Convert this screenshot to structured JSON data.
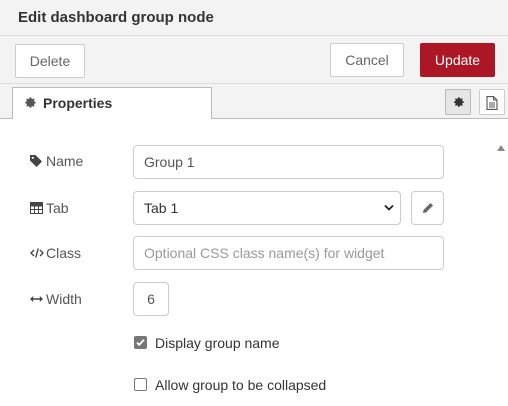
{
  "dialog": {
    "title": "Edit dashboard group node"
  },
  "toolbar": {
    "delete_label": "Delete",
    "cancel_label": "Cancel",
    "update_label": "Update"
  },
  "tabs": {
    "active_label": "Properties",
    "active_icon": "gear-icon",
    "icons": [
      "gear-icon",
      "document-icon"
    ]
  },
  "form": {
    "name": {
      "label": "Name",
      "icon": "tag-icon",
      "value": "Group 1"
    },
    "tab": {
      "label": "Tab",
      "icon": "table-icon",
      "selected": "Tab 1"
    },
    "class": {
      "label": "Class",
      "icon": "code-icon",
      "value": "",
      "placeholder": "Optional CSS class name(s) for widget"
    },
    "width": {
      "label": "Width",
      "icon": "arrows-h-icon",
      "value": "6"
    },
    "display_group_name": {
      "label": "Display group name",
      "checked": true
    },
    "allow_collapse": {
      "label": "Allow group to be collapsed",
      "checked": false
    }
  },
  "colors": {
    "accent": "#ad1625",
    "panel_bg": "#f3f3f3",
    "border": "#cccccc"
  }
}
